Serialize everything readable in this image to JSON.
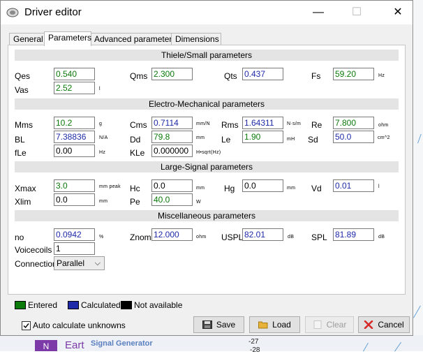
{
  "window": {
    "title": "Driver editor",
    "minimize": "—",
    "maximize": "☐",
    "close": "✕"
  },
  "tabs": [
    "General",
    "Parameters",
    "Advanced parameters",
    "Dimensions"
  ],
  "active_tab": "Parameters",
  "sections": {
    "ts": "Thiele/Small parameters",
    "em": "Electro-Mechanical parameters",
    "ls": "Large-Signal parameters",
    "misc": "Miscellaneous parameters"
  },
  "fields": {
    "qes": {
      "label": "Qes",
      "value": "0.540",
      "unit": ""
    },
    "qms": {
      "label": "Qms",
      "value": "2.300",
      "unit": ""
    },
    "qts": {
      "label": "Qts",
      "value": "0.437",
      "unit": ""
    },
    "fs": {
      "label": "Fs",
      "value": "59.20",
      "unit": "Hz"
    },
    "vas": {
      "label": "Vas",
      "value": "2.52",
      "unit": "l"
    },
    "mms": {
      "label": "Mms",
      "value": "10.2",
      "unit": "g"
    },
    "cms": {
      "label": "Cms",
      "value": "0.7114",
      "unit": "mm/N"
    },
    "rms": {
      "label": "Rms",
      "value": "1.64311",
      "unit": "N·s/m"
    },
    "re": {
      "label": "Re",
      "value": "7.800",
      "unit": "ohm"
    },
    "bl": {
      "label": "BL",
      "value": "7.38836",
      "unit": "N/A"
    },
    "dd": {
      "label": "Dd",
      "value": "79.8",
      "unit": "mm"
    },
    "le": {
      "label": "Le",
      "value": "1.90",
      "unit": "mH"
    },
    "sd": {
      "label": "Sd",
      "value": "50.0",
      "unit": "cm^2"
    },
    "fle": {
      "label": "fLe",
      "value": "0.00",
      "unit": "Hz"
    },
    "kle": {
      "label": "KLe",
      "value": "0.000000",
      "unit": "H•sqrt(Hz)"
    },
    "xmax": {
      "label": "Xmax",
      "value": "3.0",
      "unit": "mm peak"
    },
    "hc": {
      "label": "Hc",
      "value": "0.0",
      "unit": "mm"
    },
    "hg": {
      "label": "Hg",
      "value": "0.0",
      "unit": "mm"
    },
    "vd": {
      "label": "Vd",
      "value": "0.01",
      "unit": "l"
    },
    "xlim": {
      "label": "Xlim",
      "value": "0.0",
      "unit": "mm"
    },
    "pe": {
      "label": "Pe",
      "value": "40.0",
      "unit": "W"
    },
    "no": {
      "label": "no",
      "value": "0.0942",
      "unit": "%"
    },
    "znom": {
      "label": "Znom",
      "value": "12.000",
      "unit": "ohm"
    },
    "uspl": {
      "label": "USPL",
      "value": "82.01",
      "unit": "dB"
    },
    "spl": {
      "label": "SPL",
      "value": "81.89",
      "unit": "dB"
    },
    "voicecoils": {
      "label": "Voicecoils",
      "value": "1"
    }
  },
  "connection": {
    "label": "Connection",
    "value": "Parallel"
  },
  "legend": {
    "entered": {
      "label": "Entered",
      "color": "#0b7a0b"
    },
    "calculated": {
      "label": "Calculated",
      "color": "#1e2aa8"
    },
    "not_available": {
      "label": "Not available",
      "color": "#000000"
    }
  },
  "auto_calc": {
    "label": "Auto calculate unknowns",
    "checked": true
  },
  "buttons": {
    "save": "Save",
    "load": "Load",
    "clear": "Clear",
    "cancel": "Cancel"
  },
  "background": {
    "badge": "N",
    "earth": "Eart",
    "signal_generator": "Signal Generator",
    "num1": "-27",
    "num2": "-28"
  },
  "colors": {
    "entered": "#0b7a0b",
    "calculated": "#1e2aa8",
    "section_bg": "#e4e4e4"
  }
}
